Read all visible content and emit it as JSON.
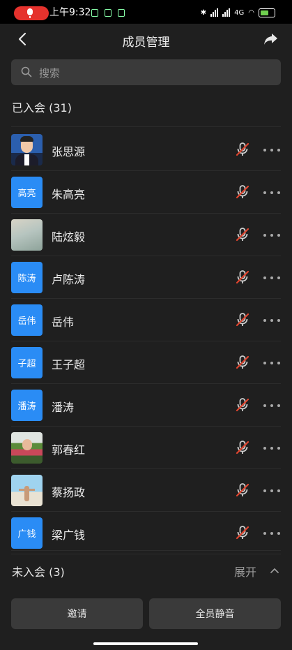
{
  "status_bar": {
    "time": "上午9:32",
    "network": "4G",
    "battery_color": "#6fd04f"
  },
  "header": {
    "title": "成员管理",
    "back_icon": "chevron-left-icon",
    "share_icon": "share-icon"
  },
  "search": {
    "placeholder": "搜索"
  },
  "joined": {
    "title": "已入会 (31)",
    "members": [
      {
        "name": "张思源",
        "avatar_type": "photo"
      },
      {
        "name": "朱高亮",
        "avatar_type": "text",
        "avatar_text": "高亮"
      },
      {
        "name": "陆炫毅",
        "avatar_type": "photo"
      },
      {
        "name": "卢陈涛",
        "avatar_type": "text",
        "avatar_text": "陈涛"
      },
      {
        "name": "岳伟",
        "avatar_type": "text",
        "avatar_text": "岳伟"
      },
      {
        "name": "王子超",
        "avatar_type": "text",
        "avatar_text": "子超"
      },
      {
        "name": "潘涛",
        "avatar_type": "text",
        "avatar_text": "潘涛"
      },
      {
        "name": "郭春红",
        "avatar_type": "photo"
      },
      {
        "name": "蔡扬政",
        "avatar_type": "photo"
      },
      {
        "name": "梁广钱",
        "avatar_type": "text",
        "avatar_text": "广钱"
      }
    ]
  },
  "not_joined": {
    "title": "未入会 (3)",
    "expand_label": "展开"
  },
  "actions": {
    "invite_label": "邀请",
    "mute_all_label": "全员静音"
  },
  "colors": {
    "avatar_blue": "#2a8cf5",
    "muted_red": "#e0452f"
  }
}
